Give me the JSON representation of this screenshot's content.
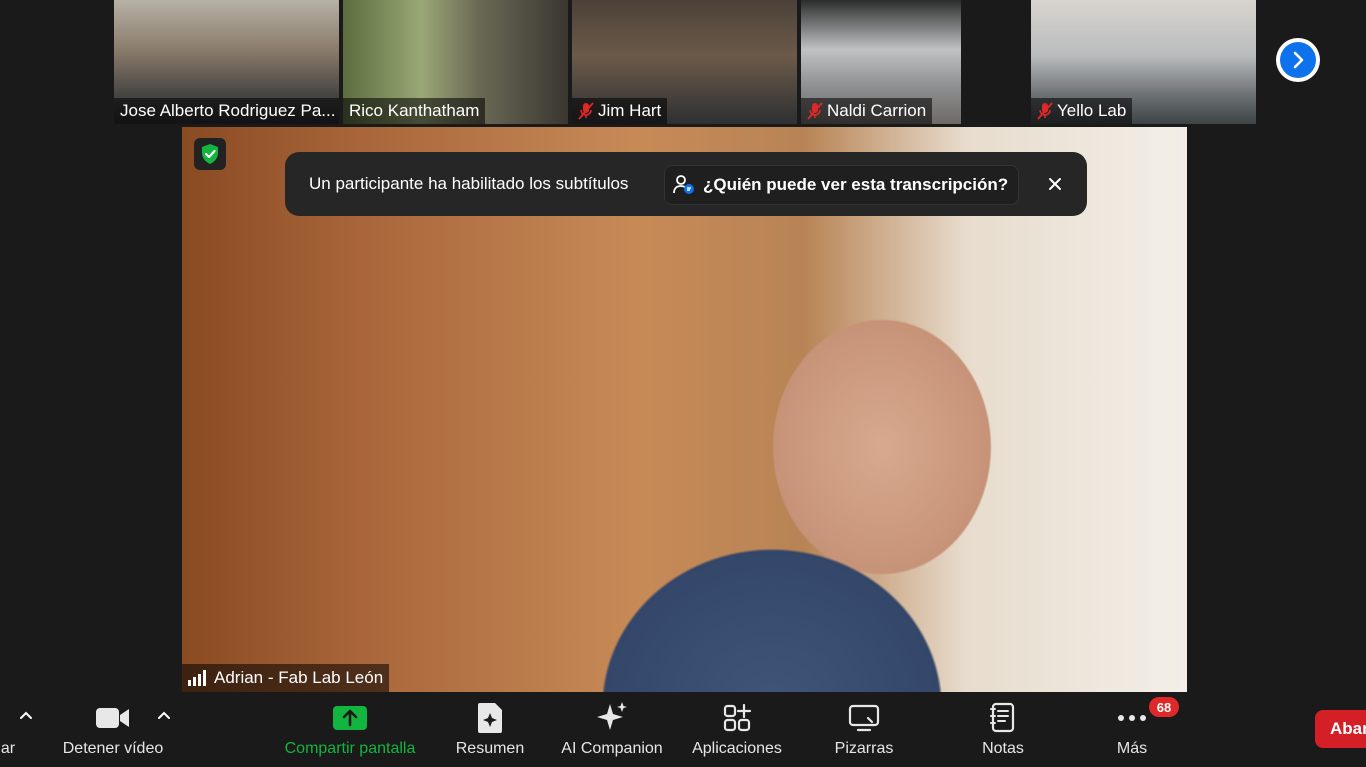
{
  "participants": [
    {
      "name": "Jose Alberto Rodriguez Pa...",
      "muted": false
    },
    {
      "name": "Rico Kanthatham",
      "muted": false
    },
    {
      "name": "Jim Hart",
      "muted": true
    },
    {
      "name": "Naldi Carrion",
      "muted": true
    },
    {
      "name": "Yello Lab",
      "muted": true
    }
  ],
  "next_page_icon": "chevron-right-icon",
  "active_speaker": {
    "name": "Adrian - Fab Lab León"
  },
  "caption_banner": {
    "message": "Un participante ha habilitado los subtítulos",
    "link_label": "¿Quién puede ver esta transcripción?"
  },
  "toolbar": {
    "audio_partial_label": "ar",
    "video_label": "Detener vídeo",
    "share_label": "Compartir pantalla",
    "summary_label": "Resumen",
    "companion_label": "AI Companion",
    "apps_label": "Aplicaciones",
    "whiteboards_label": "Pizarras",
    "notes_label": "Notas",
    "more_label": "Más",
    "more_badge": "68",
    "leave_label": "Aband"
  },
  "colors": {
    "accent_green": "#12b53f",
    "accent_blue": "#0e72ed",
    "mute_red": "#e02828",
    "leave_red": "#d41f26"
  }
}
